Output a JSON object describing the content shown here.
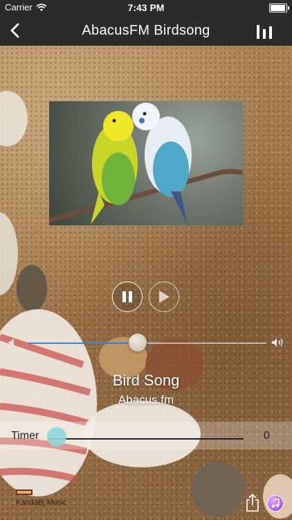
{
  "status_bar": {
    "carrier": "Carrier",
    "time": "7:43 PM",
    "battery_level": 0.95
  },
  "nav": {
    "title": "AbacusFM Birdsong",
    "back_icon": "chevron-left-icon",
    "menu_icon": "bar-chart-icon"
  },
  "player": {
    "song": "Bird Song",
    "station": "Abacus.fm",
    "volume_level": 0.5,
    "timer_label": "Timer",
    "timer_value": "0",
    "timer_position": 0
  },
  "footer": {
    "brand": "KandaBj Music",
    "share_icon": "share-icon",
    "music_icon": "music-note-icon"
  },
  "colors": {
    "nav_bg": "#2b2b2b",
    "volume_fill": "#3b82d6",
    "timer_thumb": "#8fd6df",
    "music_badge": "#9b34d8"
  }
}
